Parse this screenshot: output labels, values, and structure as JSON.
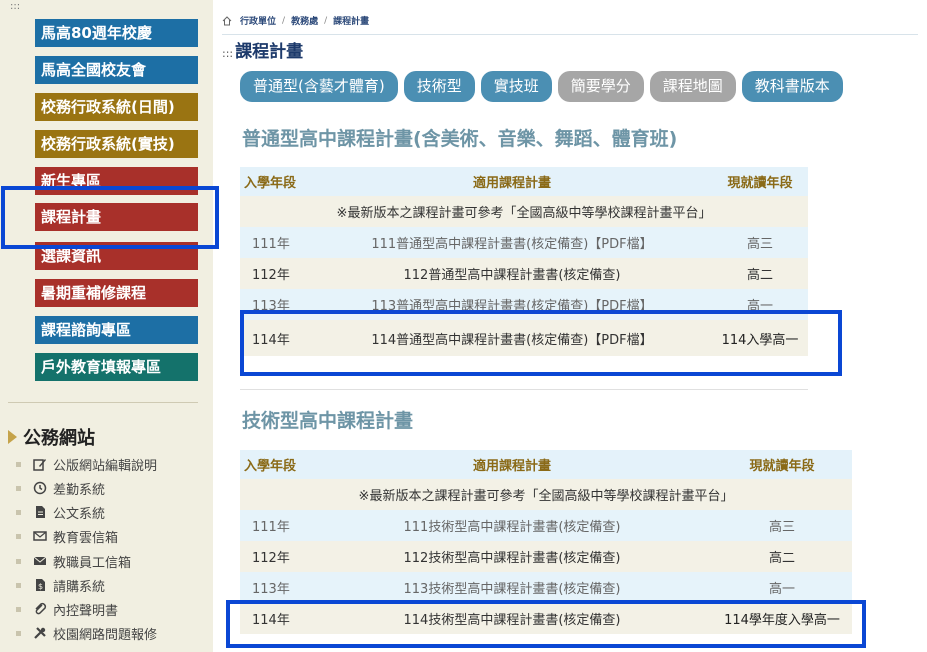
{
  "sidebar": {
    "dots": ":::",
    "menu": [
      {
        "label": "馬高80週年校慶",
        "color": "#1d6fa5"
      },
      {
        "label": "馬高全國校友會",
        "color": "#1d6fa5"
      },
      {
        "label": "校務行政系統(日間)",
        "color": "#9a7412"
      },
      {
        "label": "校務行政系統(實技)",
        "color": "#9a7412"
      },
      {
        "label": "新生專區",
        "color": "#a8302a"
      },
      {
        "label": "課程計畫",
        "color": "#a8302a"
      },
      {
        "label": "選課資訊",
        "color": "#a8302a"
      },
      {
        "label": "暑期重補修課程",
        "color": "#a8302a"
      },
      {
        "label": "課程諮詢專區",
        "color": "#1d6fa5"
      },
      {
        "label": "戶外教育填報專區",
        "color": "#14726b"
      }
    ],
    "section_title": "公務網站",
    "links": [
      {
        "label": "公版網站編輯說明",
        "icon": "edit-icon"
      },
      {
        "label": "差勤系統",
        "icon": "clock-icon"
      },
      {
        "label": "公文系統",
        "icon": "document-icon"
      },
      {
        "label": "教育雲信箱",
        "icon": "envelope-outline-icon"
      },
      {
        "label": "教職員工信箱",
        "icon": "envelope-icon"
      },
      {
        "label": "請購系統",
        "icon": "invoice-icon"
      },
      {
        "label": "內控聲明書",
        "icon": "paperclip-icon"
      },
      {
        "label": "校園網路問題報修",
        "icon": "tools-icon"
      }
    ]
  },
  "breadcrumb": {
    "home_icon": "home-icon",
    "items": [
      "行政單位",
      "教務處",
      "課程計畫"
    ]
  },
  "page_title": "課程計畫",
  "page_title_prefix": ":::",
  "tabs": [
    {
      "label": "普通型(含藝才體育)",
      "style": "blue"
    },
    {
      "label": "技術型",
      "style": "blue"
    },
    {
      "label": "實技班",
      "style": "blue"
    },
    {
      "label": "簡要學分",
      "style": "grey"
    },
    {
      "label": "課程地圖",
      "style": "grey"
    },
    {
      "label": "教科書版本",
      "style": "blue"
    }
  ],
  "general": {
    "title": "普通型高中課程計畫(含美術、音樂、舞蹈、體育班)",
    "headers": [
      "入學年段",
      "適用課程計畫",
      "現就讀年段"
    ],
    "notice": "※最新版本之課程計畫可參考「全國高級中等學校課程計畫平台」",
    "rows": [
      {
        "year": "111年",
        "plan": "111普通型高中課程計畫書(核定備查)【PDF檔】",
        "grade": "高三"
      },
      {
        "year": "112年",
        "plan": "112普通型高中課程計畫書(核定備查)",
        "grade": "高二"
      },
      {
        "year": "113年",
        "plan": "113普通型高中課程計畫書(核定備查)【PDF檔】",
        "grade": "高一"
      },
      {
        "year": "114年",
        "plan": "114普通型高中課程計畫書(核定備查)【PDF檔】",
        "grade": "114入學高一"
      }
    ]
  },
  "technical": {
    "title": "技術型高中課程計畫",
    "headers": [
      "入學年段",
      "適用課程計畫",
      "現就讀年段"
    ],
    "notice": "※最新版本之課程計畫可參考「全國高級中等學校課程計畫平台」",
    "rows": [
      {
        "year": "111年",
        "plan": "111技術型高中課程計畫書(核定備查)",
        "grade": "高三"
      },
      {
        "year": "112年",
        "plan": "112技術型高中課程計畫書(核定備查)",
        "grade": "高二"
      },
      {
        "year": "113年",
        "plan": "113技術型高中課程計畫書(核定備查)",
        "grade": "高一"
      },
      {
        "year": "114年",
        "plan": "114技術型高中課程計畫書(核定備查)",
        "grade": "114學年度入學高一"
      }
    ]
  },
  "colors": {
    "highlight": "#0a47d4",
    "header_text": "#8a6a17",
    "section_title": "#6e95a6"
  }
}
